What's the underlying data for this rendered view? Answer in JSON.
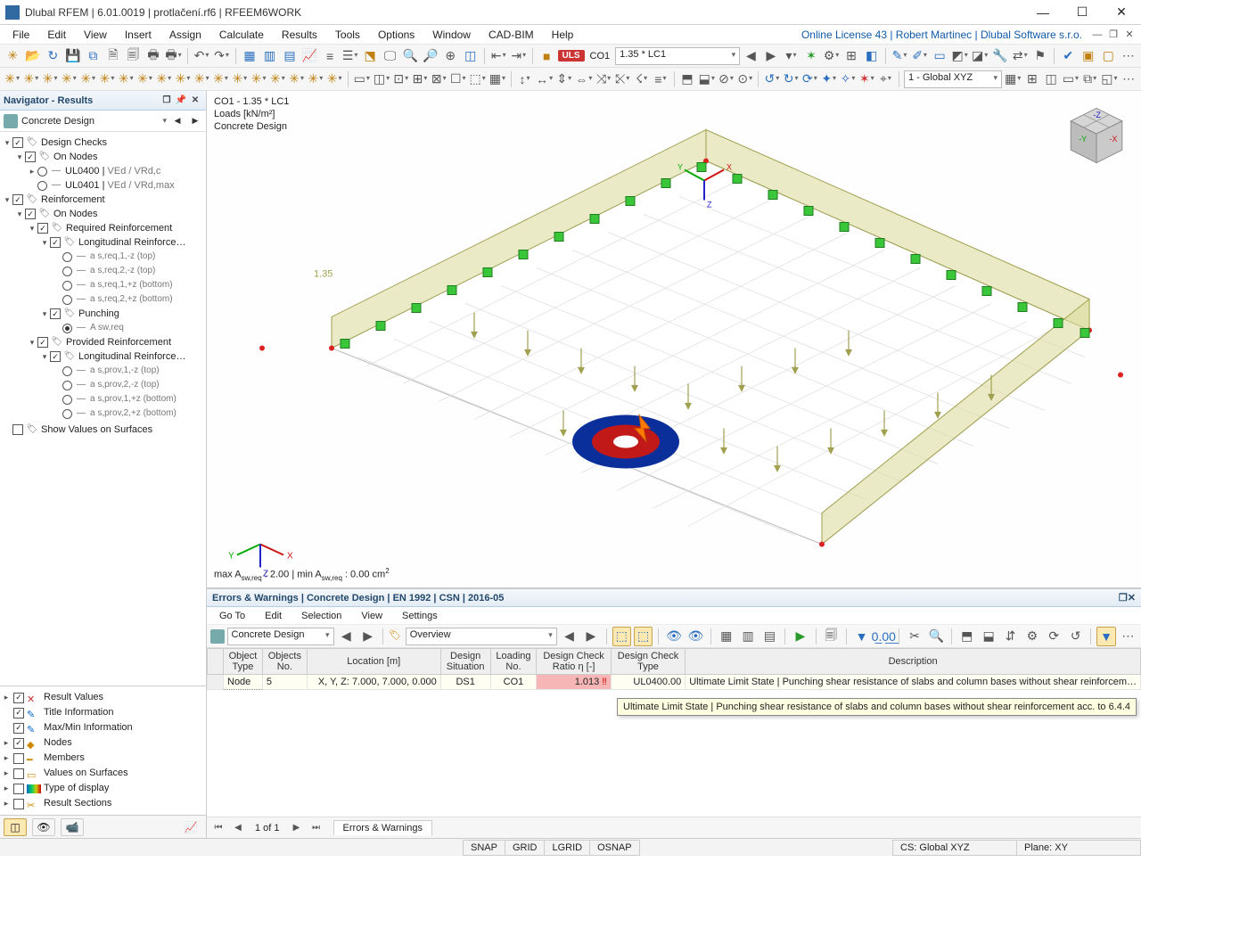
{
  "titlebar": {
    "text": "Dlubal RFEM | 6.01.0019 | protlačení.rf6 | RFEEM6WORK"
  },
  "menubar": {
    "items": [
      "File",
      "Edit",
      "View",
      "Insert",
      "Assign",
      "Calculate",
      "Results",
      "Tools",
      "Options",
      "Window",
      "CAD-BIM",
      "Help"
    ],
    "license": "Online License 43 | Robert Martinec | Dlubal Software s.r.o."
  },
  "toolbar1": {
    "uls": "ULS",
    "co_label": "CO1",
    "co_combo": "1.35 * LC1",
    "global_combo": "1 - Global XYZ"
  },
  "navigator": {
    "title": "Navigator - Results",
    "selector": "Concrete Design",
    "tree": {
      "design_checks": "Design Checks",
      "on_nodes_1": "On Nodes",
      "ul0400": "UL0400 | ",
      "ul0400_sub": "VEd / VRd,c",
      "ul0401": "UL0401 | ",
      "ul0401_sub": "VEd / VRd,max",
      "reinforcement": "Reinforcement",
      "on_nodes_2": "On Nodes",
      "req_reinf": "Required Reinforcement",
      "long_reinf_1": "Longitudinal Reinforce…",
      "as_req_1mz": "a s,req,1,-z (top)",
      "as_req_2mz": "a s,req,2,-z (top)",
      "as_req_1pz": "a s,req,1,+z (bottom)",
      "as_req_2pz": "a s,req,2,+z (bottom)",
      "punching": "Punching",
      "asw_req": "A sw,req",
      "prov_reinf": "Provided Reinforcement",
      "long_reinf_2": "Longitudinal Reinforce…",
      "as_prov_1mz": "a s,prov,1,-z (top)",
      "as_prov_2mz": "a s,prov,2,-z (top)",
      "as_prov_1pz": "a s,prov,1,+z (bottom)",
      "as_prov_2pz": "a s,prov,2,+z (bottom)",
      "show_values": "Show Values on Surfaces"
    },
    "display": {
      "result_values": "Result Values",
      "title_info": "Title Information",
      "maxmin": "Max/Min Information",
      "nodes": "Nodes",
      "members": "Members",
      "values_surf": "Values on Surfaces",
      "type_disp": "Type of display",
      "result_sect": "Result Sections"
    }
  },
  "viewport": {
    "line1": "CO1 - 1.35 * LC1",
    "line2": "Loads [kN/m²]",
    "line3": "Concrete Design",
    "factor": "1.35",
    "bottom_line": "max A sw,req : 2.00 | min A sw,req : 0.00 cm²"
  },
  "ew_panel": {
    "title": "Errors & Warnings | Concrete Design | EN 1992 | CSN | 2016-05",
    "menu": [
      "Go To",
      "Edit",
      "Selection",
      "View",
      "Settings"
    ],
    "selector1": "Concrete Design",
    "selector2": "Overview",
    "headers": {
      "obj_type": "Object\nType",
      "obj_no": "Objects\nNo.",
      "location": "Location [m]",
      "design_sit": "Design\nSituation",
      "loading_no": "Loading\nNo.",
      "ratio": "Design Check\nRatio η [-]",
      "dc_type": "Design Check\nType",
      "description": "Description"
    },
    "row": {
      "obj_type": "Node",
      "obj_no": "5",
      "location": "X, Y, Z: 7.000, 7.000, 0.000",
      "design_sit": "DS1",
      "loading_no": "CO1",
      "ratio": "1.013",
      "ratio_flag": "‼",
      "dc_type": "UL0400.00",
      "description": "Ultimate Limit State | Punching shear resistance of slabs and column bases without shear reinforcem…"
    },
    "tooltip": "Ultimate Limit State | Punching shear resistance of slabs and column bases without shear reinforcement acc. to 6.4.4",
    "pager": "1 of 1",
    "tab": "Errors & Warnings"
  },
  "statusbar": {
    "snap": "SNAP",
    "grid": "GRID",
    "lgrid": "LGRID",
    "osnap": "OSNAP",
    "cs": "CS: Global XYZ",
    "plane": "Plane: XY"
  }
}
